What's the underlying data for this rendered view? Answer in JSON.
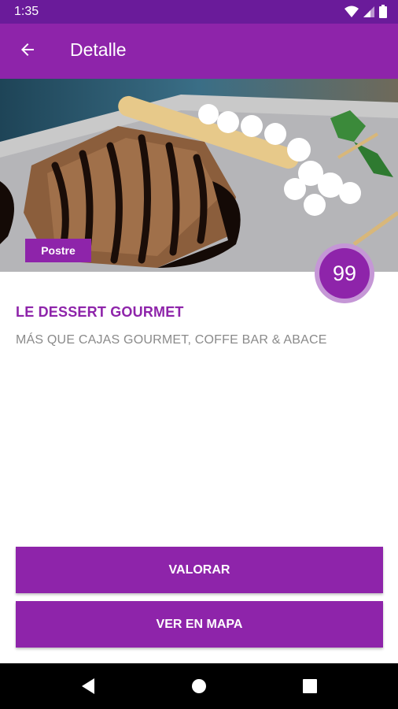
{
  "status_bar": {
    "time": "1:35",
    "icons": [
      "wifi-icon",
      "signal-icon",
      "battery-icon"
    ]
  },
  "app_bar": {
    "title": "Detalle",
    "back_icon": "arrow-left-icon"
  },
  "place": {
    "category": "Postre",
    "score": "99",
    "name": "LE DESSERT GOURMET",
    "description": "MÁS QUE CAJAS GOURMET, COFFE BAR & ABACE"
  },
  "actions": {
    "rate_label": "VALORAR",
    "map_label": "VER EN MAPA"
  },
  "nav": {
    "icons": [
      "back-triangle-icon",
      "home-circle-icon",
      "recents-square-icon"
    ]
  },
  "colors": {
    "primary": "#8e24aa",
    "primary_dark": "#6a1b9a",
    "ring": "#c597d6",
    "muted_text": "#8a8a8a"
  }
}
